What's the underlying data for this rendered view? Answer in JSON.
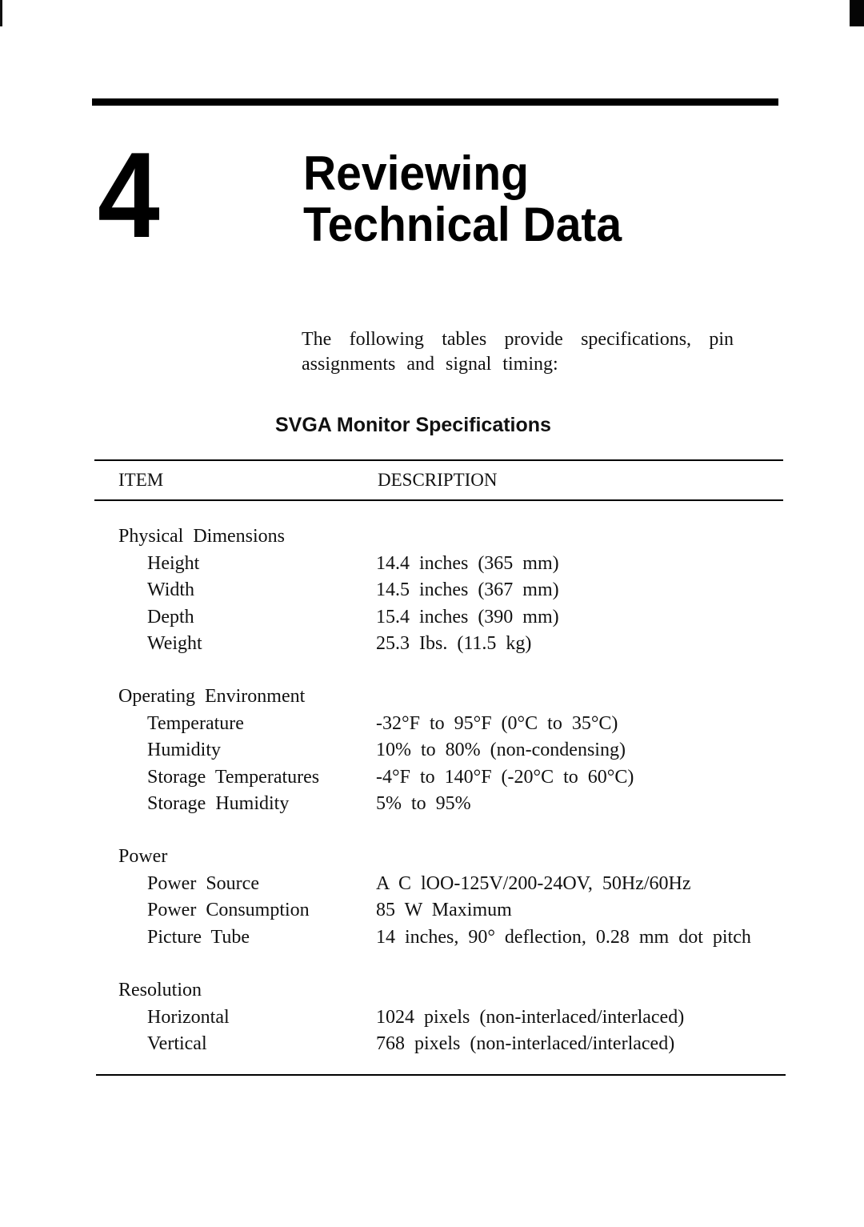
{
  "chapter": {
    "number": "4",
    "title_line1": "Reviewing",
    "title_line2": "Technical Data"
  },
  "intro_text": "The following tables provide specifications, pin assignments and signal timing:",
  "table": {
    "title": "SVGA Monitor Specifications",
    "headers": {
      "item": "ITEM",
      "description": "DESCRIPTION"
    },
    "groups": [
      {
        "heading": "Physical Dimensions",
        "rows": [
          {
            "item": "Height",
            "description": "14.4 inches (365 mm)"
          },
          {
            "item": "Width",
            "description": "14.5 inches (367 mm)"
          },
          {
            "item": "Depth",
            "description": "15.4 inches (390 mm)"
          },
          {
            "item": "Weight",
            "description": "25.3 Ibs. (11.5 kg)"
          }
        ]
      },
      {
        "heading": "Operating Environment",
        "rows": [
          {
            "item": "Temperature",
            "description": "-32°F to 95°F (0°C to 35°C)"
          },
          {
            "item": "Humidity",
            "description": "10% to 80% (non-condensing)"
          },
          {
            "item": "Storage Temperatures",
            "description": "-4°F to 140°F (-20°C to 60°C)"
          },
          {
            "item": "Storage Humidity",
            "description": "5% to 95%"
          }
        ]
      },
      {
        "heading": "Power",
        "rows": [
          {
            "item": "Power Source",
            "description": "A C lOO-125V/200-24OV, 50Hz/60Hz"
          },
          {
            "item": "Power Consumption",
            "description": "85 W Maximum"
          },
          {
            "item": "Picture Tube",
            "description": "14 inches, 90° deflection, 0.28 mm dot pitch"
          }
        ]
      },
      {
        "heading": "Resolution",
        "rows": [
          {
            "item": "Horizontal",
            "description": "1024 pixels (non-interlaced/interlaced)"
          },
          {
            "item": "Vertical",
            "description": "768 pixels (non-interlaced/interlaced)"
          }
        ]
      }
    ]
  }
}
